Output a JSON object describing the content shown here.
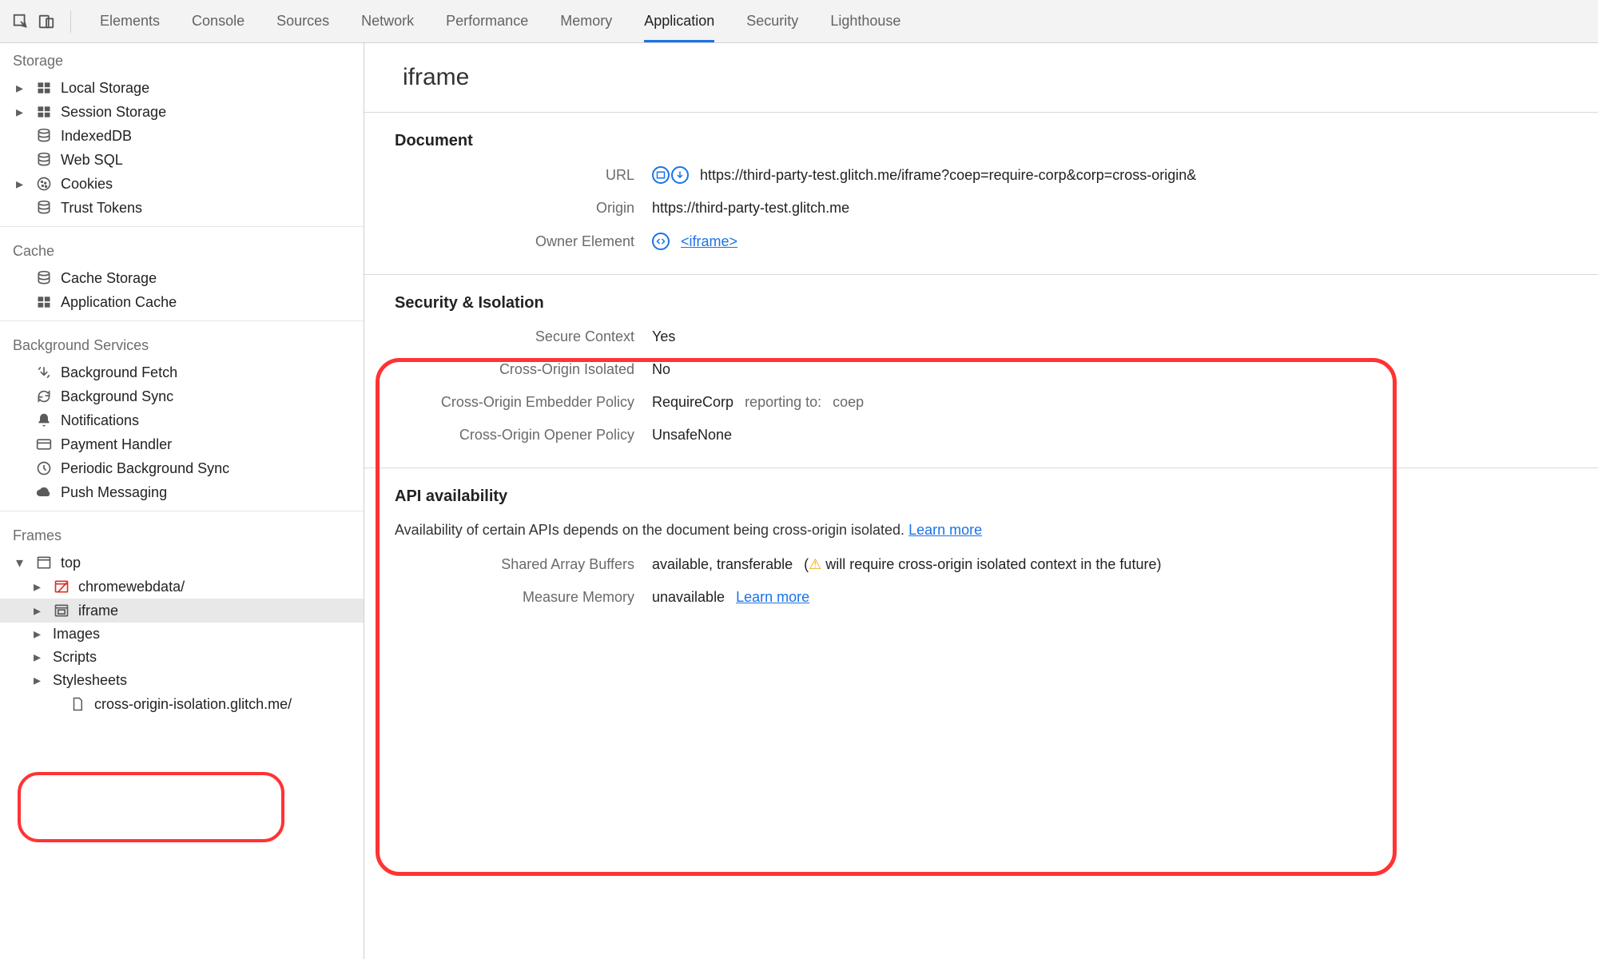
{
  "toolbar": {
    "tabs": [
      "Elements",
      "Console",
      "Sources",
      "Network",
      "Performance",
      "Memory",
      "Application",
      "Security",
      "Lighthouse"
    ],
    "active_tab": "Application"
  },
  "sidebar": {
    "sections": {
      "storage": {
        "title": "Storage",
        "items": [
          {
            "label": "Local Storage",
            "expandable": true
          },
          {
            "label": "Session Storage",
            "expandable": true
          },
          {
            "label": "IndexedDB",
            "expandable": false
          },
          {
            "label": "Web SQL",
            "expandable": false
          },
          {
            "label": "Cookies",
            "expandable": true
          },
          {
            "label": "Trust Tokens",
            "expandable": false
          }
        ]
      },
      "cache": {
        "title": "Cache",
        "items": [
          {
            "label": "Cache Storage",
            "expandable": false
          },
          {
            "label": "Application Cache",
            "expandable": false
          }
        ]
      },
      "background": {
        "title": "Background Services",
        "items": [
          {
            "label": "Background Fetch"
          },
          {
            "label": "Background Sync"
          },
          {
            "label": "Notifications"
          },
          {
            "label": "Payment Handler"
          },
          {
            "label": "Periodic Background Sync"
          },
          {
            "label": "Push Messaging"
          }
        ]
      },
      "frames": {
        "title": "Frames",
        "top_label": "top",
        "children": [
          {
            "label": "chromewebdata/",
            "red": true
          },
          {
            "label": "iframe",
            "selected": true
          }
        ],
        "grandchildren": [
          {
            "label": "Images"
          },
          {
            "label": "Scripts"
          },
          {
            "label": "Stylesheets"
          }
        ],
        "leaf": {
          "label": "cross-origin-isolation.glitch.me/"
        }
      }
    }
  },
  "content": {
    "title": "iframe",
    "document": {
      "heading": "Document",
      "url_label": "URL",
      "url": "https://third-party-test.glitch.me/iframe?coep=require-corp&corp=cross-origin&",
      "origin_label": "Origin",
      "origin": "https://third-party-test.glitch.me",
      "owner_label": "Owner Element",
      "owner_link": "<iframe>"
    },
    "security": {
      "heading": "Security & Isolation",
      "secure_context_label": "Secure Context",
      "secure_context": "Yes",
      "coi_label": "Cross-Origin Isolated",
      "coi": "No",
      "coep_label": "Cross-Origin Embedder Policy",
      "coep": "RequireCorp",
      "coep_reporting_label": "reporting to:",
      "coep_reporting": "coep",
      "coop_label": "Cross-Origin Opener Policy",
      "coop": "UnsafeNone"
    },
    "api": {
      "heading": "API availability",
      "desc": "Availability of certain APIs depends on the document being cross-origin isolated.",
      "learn_more": "Learn more",
      "sab_label": "Shared Array Buffers",
      "sab_value": "available, transferable",
      "sab_warning": "will require cross-origin isolated context in the future)",
      "mm_label": "Measure Memory",
      "mm_value": "unavailable",
      "mm_learn": "Learn more"
    }
  }
}
